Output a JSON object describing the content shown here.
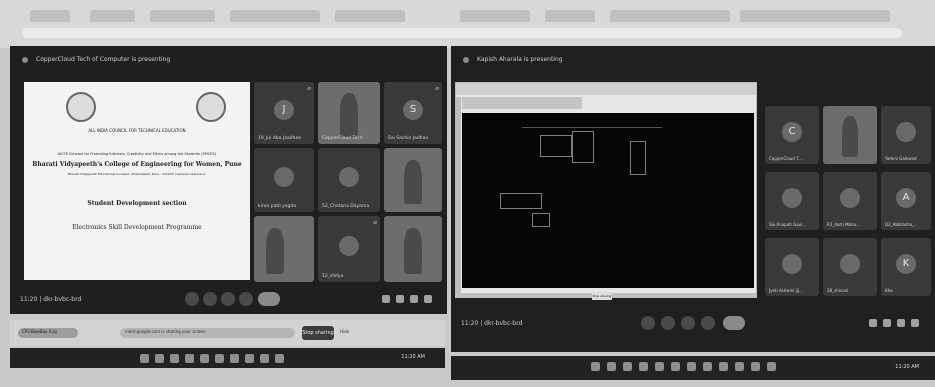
{
  "left_meeting": {
    "header": "CopperCloud Tech of Computer is presenting",
    "slide": {
      "org": "ALL INDIA COUNCIL FOR TECHNICAL EDUCATION",
      "scheme": "AICTE Scheme for Promoting Interests, Creativity and Ethics among the Students (SPICES)",
      "college": "Bharati Vidyapeeth's College of Engineering for Women, Pune",
      "address": "Bharati Vidyapeeth Educational Complex, Dhankawadi, Pune - 411043 | www.bvcoew.edu.in",
      "section": "Student Development section",
      "program": "Electronics Skill Development Programme"
    },
    "participants": [
      {
        "initial": "J",
        "name": "19_Jui Aba Jaadhao"
      },
      {
        "initial": "",
        "name": "CopperCloud Tech"
      },
      {
        "initial": "S",
        "name": "Sai Sachin Jadhav"
      },
      {
        "initial": "",
        "name": "kiran patil yogita"
      },
      {
        "initial": "",
        "name": "52_Chetana Dayama"
      },
      {
        "initial": "",
        "name": ""
      },
      {
        "initial": "",
        "name": ""
      },
      {
        "initial": "",
        "name": "12_shifya"
      },
      {
        "initial": "",
        "name": ""
      }
    ],
    "time": "11:20",
    "meeting_code": "dkr-bvbc-brd"
  },
  "share_strip": {
    "text": "CP3 BlueBox 0.py",
    "url_hint": "meet.google.com is sharing your screen",
    "stop_label": "Stop sharing",
    "hide_label": "Hide"
  },
  "right_meeting": {
    "header": "Kapish Aharala is presenting",
    "share_tag": "Stop sharing",
    "participants": [
      {
        "initial": "C",
        "name": "CopperCloud T...",
        "photo": false
      },
      {
        "initial": "",
        "name": "",
        "photo": true
      },
      {
        "initial": "",
        "name": "Yamini Gaikwad",
        "photo": false
      },
      {
        "initial": "",
        "name": "Sai Anupati Gavi...",
        "photo": false
      },
      {
        "initial": "",
        "name": "R3_Aarti Mana...",
        "photo": false
      },
      {
        "initial": "A",
        "name": "D2_Abhilasha_...",
        "photo": false
      },
      {
        "initial": "",
        "name": "Jyoti Ashwini Jij...",
        "photo": false
      },
      {
        "initial": "",
        "name": "28_shivani",
        "photo": false
      },
      {
        "initial": "K",
        "name": "Kha",
        "photo": false
      }
    ],
    "time": "11:20",
    "meeting_code": "dkr-bvbc-brd"
  },
  "taskbar": {
    "left_clock": "11:20 AM",
    "right_clock": "11:20 AM"
  }
}
